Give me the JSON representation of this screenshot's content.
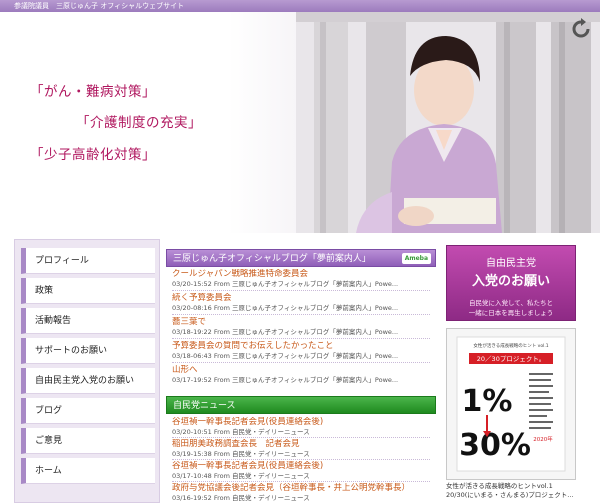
{
  "header": {
    "strip_text": "参議院議員　三原じゅん子 オフィシャルウェブサイト"
  },
  "hero": {
    "slogans": [
      "「がん・難病対策」",
      "「介護制度の充実」",
      "「少子高齢化対策」"
    ]
  },
  "nav": {
    "items": [
      "プロフィール",
      "政策",
      "活動報告",
      "サポートのお願い",
      "自由民主党入党のお願い",
      "ブログ",
      "ご意見",
      "ホーム"
    ]
  },
  "blog": {
    "heading": "三原じゅん子オフィシャルブログ「夢前案内人」",
    "badge": "Ameba",
    "entries": [
      {
        "title": "クールジャパン戦略推進特命委員会",
        "meta": "03/20-15:52 From 三原じゅん子オフィシャルブログ「夢前案内人」Powe..."
      },
      {
        "title": "続く予算委員会",
        "meta": "03/20-08:16 From 三原じゅん子オフィシャルブログ「夢前案内人」Powe..."
      },
      {
        "title": "蕎三葉で",
        "meta": "03/18-19:22 From 三原じゅん子オフィシャルブログ「夢前案内人」Powe..."
      },
      {
        "title": "予算委員会の質問でお伝えしたかったこと",
        "meta": "03/18-06:43 From 三原じゅん子オフィシャルブログ「夢前案内人」Powe..."
      },
      {
        "title": "山形へ",
        "meta": "03/17-19:52 From 三原じゅん子オフィシャルブログ「夢前案内人」Powe..."
      }
    ]
  },
  "news": {
    "heading": "自民党ニュース",
    "entries": [
      {
        "title": "谷垣禎一幹事長記者会見(役員連絡会後)",
        "meta": "03/20-10:51 From 自民党・デイリーニュース"
      },
      {
        "title": "稲田朋美政務調査会長　記者会見",
        "meta": "03/19-15:38 From 自民党・デイリーニュース"
      },
      {
        "title": "谷垣禎一幹事長記者会見(役員連絡会後)",
        "meta": "03/17-10:48 From 自民党・デイリーニュース"
      },
      {
        "title": "政府与党協議会後記者会見（谷垣幹事長・井上公明党幹事長）",
        "meta": "03/16-19:52 From 自民党・デイリーニュース"
      }
    ]
  },
  "join": {
    "title": "自由民主党",
    "subtitle": "入党のお願い",
    "note1": "自民党に入党して、私たちと",
    "note2": "一緒に日本を再生しましょう"
  },
  "book": {
    "topline": "女性が活きる成長戦略のヒント vol.1",
    "project": "20／30プロジェクト。",
    "big1": "1%",
    "big2": "30%",
    "year": "2020年",
    "caption": "女性が活きる成長戦略のヒントvol.1 20/30(にいまる・さんまる)プロジェクト..."
  },
  "colors": {
    "accent_purple": "#8f5fb8",
    "slogan_magenta": "#b0175f",
    "news_green": "#1f8a1f",
    "join_magenta": "#a8389c",
    "link_orange": "#c85a1a"
  },
  "icons": {
    "top_right": "reload-icon",
    "badge": "ameba-logo"
  }
}
